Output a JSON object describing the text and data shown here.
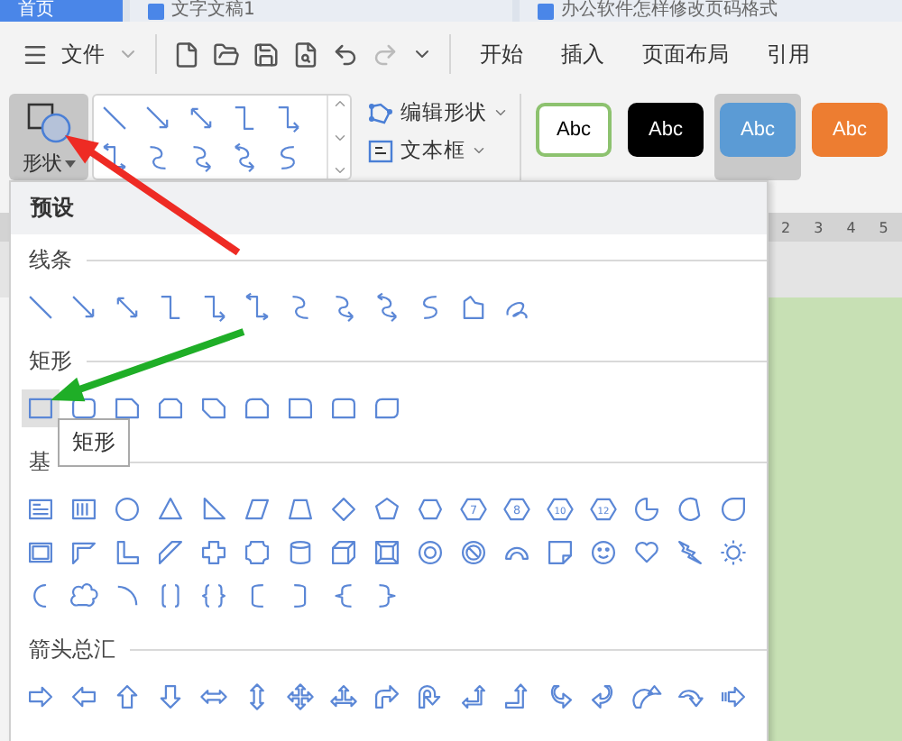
{
  "tabs": [
    {
      "label": "首页",
      "selected": true
    },
    {
      "label": "文字文稿1",
      "selected": false
    },
    {
      "label": "办公软件怎样修改页码格式",
      "selected": false
    }
  ],
  "toolbar": {
    "file_menu": "文件",
    "ribbon_tabs": [
      "开始",
      "插入",
      "页面布局",
      "引用"
    ]
  },
  "ribbon": {
    "shape_button": {
      "label": "形状",
      "selected": true
    },
    "line_gallery": [
      {
        "kind": "line"
      },
      {
        "kind": "arrow-line"
      },
      {
        "kind": "double-arrow-line"
      },
      {
        "kind": "elbow"
      },
      {
        "kind": "elbow-arrow"
      },
      {
        "kind": "elbow-double-arrow"
      },
      {
        "kind": "curve"
      },
      {
        "kind": "curve-arrow"
      },
      {
        "kind": "curve-double-arrow"
      },
      {
        "kind": "scribble-s"
      }
    ],
    "edit_shape": "编辑形状",
    "text_box": "文本框",
    "styles": [
      {
        "label": "Abc",
        "kind": "outline",
        "color": "#8dc26f",
        "selected": false
      },
      {
        "label": "Abc",
        "kind": "fill",
        "color": "#000000",
        "selected": false
      },
      {
        "label": "Abc",
        "kind": "fill",
        "color": "#5b9bd5",
        "selected": true
      },
      {
        "label": "Abc",
        "kind": "fill",
        "color": "#ed7d31",
        "selected": false
      }
    ]
  },
  "shape_menu": {
    "header": "预设",
    "sections": [
      {
        "title": "线条",
        "rows": [
          [
            {
              "kind": "line",
              "selected": false
            },
            {
              "kind": "arrow-line",
              "selected": false
            },
            {
              "kind": "double-arrow-line",
              "selected": false
            },
            {
              "kind": "elbow",
              "selected": false
            },
            {
              "kind": "elbow-arrow",
              "selected": false
            },
            {
              "kind": "elbow-double-arrow",
              "selected": false
            },
            {
              "kind": "curve",
              "selected": false
            },
            {
              "kind": "curve-arrow",
              "selected": false
            },
            {
              "kind": "curve-double-arrow",
              "selected": false
            },
            {
              "kind": "scribble-s",
              "selected": false
            },
            {
              "kind": "freeform",
              "selected": false
            },
            {
              "kind": "scribble",
              "selected": false
            }
          ]
        ]
      },
      {
        "title": "矩形",
        "rows": [
          [
            {
              "kind": "rect",
              "selected": true
            },
            {
              "kind": "rounded-rect",
              "selected": false
            },
            {
              "kind": "snip-corner",
              "selected": false
            },
            {
              "kind": "snip-two",
              "selected": false
            },
            {
              "kind": "snip-diag",
              "selected": false
            },
            {
              "kind": "snip-round",
              "selected": false
            },
            {
              "kind": "round-single",
              "selected": false
            },
            {
              "kind": "round-two",
              "selected": false
            },
            {
              "kind": "round-diag",
              "selected": false
            }
          ]
        ]
      },
      {
        "title": "基",
        "tooltip": "矩形",
        "rows": [
          [
            {
              "kind": "text-box",
              "selected": false
            },
            {
              "kind": "vertical-text-box",
              "selected": false
            },
            {
              "kind": "ellipse",
              "selected": false
            },
            {
              "kind": "triangle",
              "selected": false
            },
            {
              "kind": "right-triangle",
              "selected": false
            },
            {
              "kind": "parallelogram",
              "selected": false
            },
            {
              "kind": "trapezoid",
              "selected": false
            },
            {
              "kind": "diamond",
              "selected": false
            },
            {
              "kind": "pentagon",
              "selected": false
            },
            {
              "kind": "hexagon",
              "selected": false
            },
            {
              "kind": "numbered",
              "label": "7",
              "selected": false
            },
            {
              "kind": "numbered",
              "label": "8",
              "selected": false
            },
            {
              "kind": "numbered",
              "label": "10",
              "selected": false
            },
            {
              "kind": "numbered",
              "label": "12",
              "selected": false
            },
            {
              "kind": "pie",
              "selected": false
            },
            {
              "kind": "chord",
              "selected": false
            },
            {
              "kind": "teardrop",
              "selected": false
            }
          ],
          [
            {
              "kind": "frame",
              "selected": false
            },
            {
              "kind": "half-frame",
              "selected": false
            },
            {
              "kind": "l-shape",
              "selected": false
            },
            {
              "kind": "diagonal-stripe",
              "selected": false
            },
            {
              "kind": "cross",
              "selected": false
            },
            {
              "kind": "plaque",
              "selected": false
            },
            {
              "kind": "can",
              "selected": false
            },
            {
              "kind": "cube",
              "selected": false
            },
            {
              "kind": "bevel",
              "selected": false
            },
            {
              "kind": "donut",
              "selected": false
            },
            {
              "kind": "no-symbol",
              "selected": false
            },
            {
              "kind": "block-arc",
              "selected": false
            },
            {
              "kind": "folded-corner",
              "selected": false
            },
            {
              "kind": "smiley",
              "selected": false
            },
            {
              "kind": "heart",
              "selected": false
            },
            {
              "kind": "lightning",
              "selected": false
            },
            {
              "kind": "sun",
              "selected": false
            }
          ],
          [
            {
              "kind": "moon",
              "selected": false
            },
            {
              "kind": "cloud",
              "selected": false
            },
            {
              "kind": "arc",
              "selected": false
            },
            {
              "kind": "double-bracket",
              "selected": false
            },
            {
              "kind": "double-brace",
              "selected": false
            },
            {
              "kind": "left-bracket",
              "selected": false
            },
            {
              "kind": "right-bracket",
              "selected": false
            },
            {
              "kind": "left-brace",
              "selected": false
            },
            {
              "kind": "right-brace",
              "selected": false
            }
          ]
        ]
      },
      {
        "title": "箭头总汇",
        "rows": [
          [
            {
              "kind": "right-arrow",
              "selected": false
            },
            {
              "kind": "left-arrow",
              "selected": false
            },
            {
              "kind": "up-arrow",
              "selected": false
            },
            {
              "kind": "down-arrow",
              "selected": false
            },
            {
              "kind": "left-right-arrow",
              "selected": false
            },
            {
              "kind": "up-down-arrow",
              "selected": false
            },
            {
              "kind": "quad-arrow",
              "selected": false
            },
            {
              "kind": "left-right-up-arrow",
              "selected": false
            },
            {
              "kind": "bent-arrow",
              "selected": false
            },
            {
              "kind": "u-turn-arrow",
              "selected": false
            },
            {
              "kind": "left-up-arrow",
              "selected": false
            },
            {
              "kind": "bent-up-arrow",
              "selected": false
            },
            {
              "kind": "curved-right-arrow",
              "selected": false
            },
            {
              "kind": "curved-left-arrow",
              "selected": false
            },
            {
              "kind": "curved-up-arrow",
              "selected": false
            },
            {
              "kind": "curved-down-arrow",
              "selected": false
            },
            {
              "kind": "striped-right-arrow",
              "selected": false
            }
          ]
        ]
      }
    ]
  },
  "ruler": [
    "2",
    "3",
    "4",
    "5"
  ]
}
